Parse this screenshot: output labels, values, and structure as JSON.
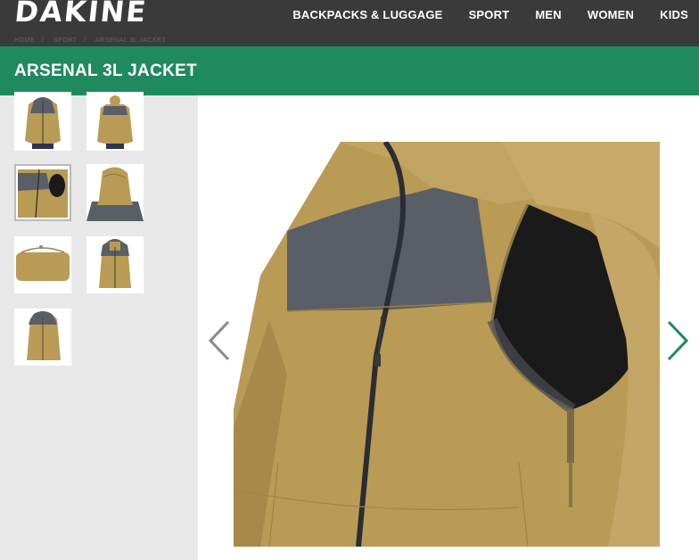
{
  "brand": {
    "logo_text": "DAKINE"
  },
  "nav": {
    "items": [
      {
        "label": "BACKPACKS & LUGGAGE"
      },
      {
        "label": "SPORT"
      },
      {
        "label": "MEN"
      },
      {
        "label": "WOMEN"
      },
      {
        "label": "KIDS"
      }
    ]
  },
  "breadcrumb": [
    "HOME",
    "SPORT",
    "ARSENAL 3L JACKET"
  ],
  "product": {
    "title": "ARSENAL 3L JACKET"
  },
  "colors": {
    "nav_bg": "#3a3a3a",
    "title_bar": "#1e8a5e",
    "next_arrow": "#1e8a5e",
    "prev_arrow": "#8a8a8a",
    "jacket_tan": "#b99b55",
    "jacket_slate": "#5a5e66"
  },
  "gallery": {
    "thumbnails": [
      {
        "icon": "jacket-front-thumb"
      },
      {
        "icon": "jacket-back-thumb"
      },
      {
        "icon": "jacket-vent-detail-thumb",
        "selected": true
      },
      {
        "icon": "jacket-hood-detail-thumb"
      },
      {
        "icon": "jacket-stuff-sack-thumb"
      },
      {
        "icon": "jacket-front-alt-thumb"
      },
      {
        "icon": "jacket-side-thumb"
      }
    ],
    "prev_icon": "chevron-left-icon",
    "next_icon": "chevron-right-icon"
  }
}
